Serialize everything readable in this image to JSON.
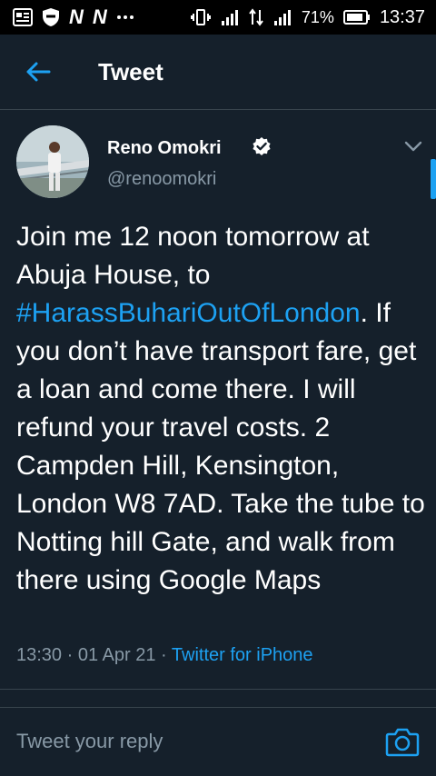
{
  "status_bar": {
    "time": "13:37",
    "battery": "71%",
    "icons": [
      "news-icon",
      "shield-icon",
      "n-icon",
      "n-icon",
      "more-dots-icon",
      "vibrate-icon",
      "signal-icon",
      "data-transfer-icon",
      "signal-icon",
      "battery-icon"
    ]
  },
  "header": {
    "title": "Tweet",
    "back_icon": "arrow-left-icon"
  },
  "tweet": {
    "author_name": "Reno Omokri",
    "author_handle": "@renoomokri",
    "text_part1": "Join me 12 noon tomorrow at Abuja House, to",
    "hashtag": "#HarassBuhariOutOfLondon",
    "text_part2": ". If you don’t have transport fare, get a loan and come there. I will refund your travel costs. 2 Campden Hill, Kensington, London W8 7AD. Take the tube to Notting hill Gate, and walk from there using Google Maps",
    "time": "13:30",
    "separator": "·",
    "date": "01 Apr 21",
    "source": "Twitter for iPhone"
  },
  "reply": {
    "placeholder": "Tweet your reply",
    "camera_icon": "camera-icon"
  },
  "colors": {
    "background": "#15202b",
    "accent": "#1da1f2",
    "secondary_text": "#8899a6",
    "divider": "#38444d"
  }
}
